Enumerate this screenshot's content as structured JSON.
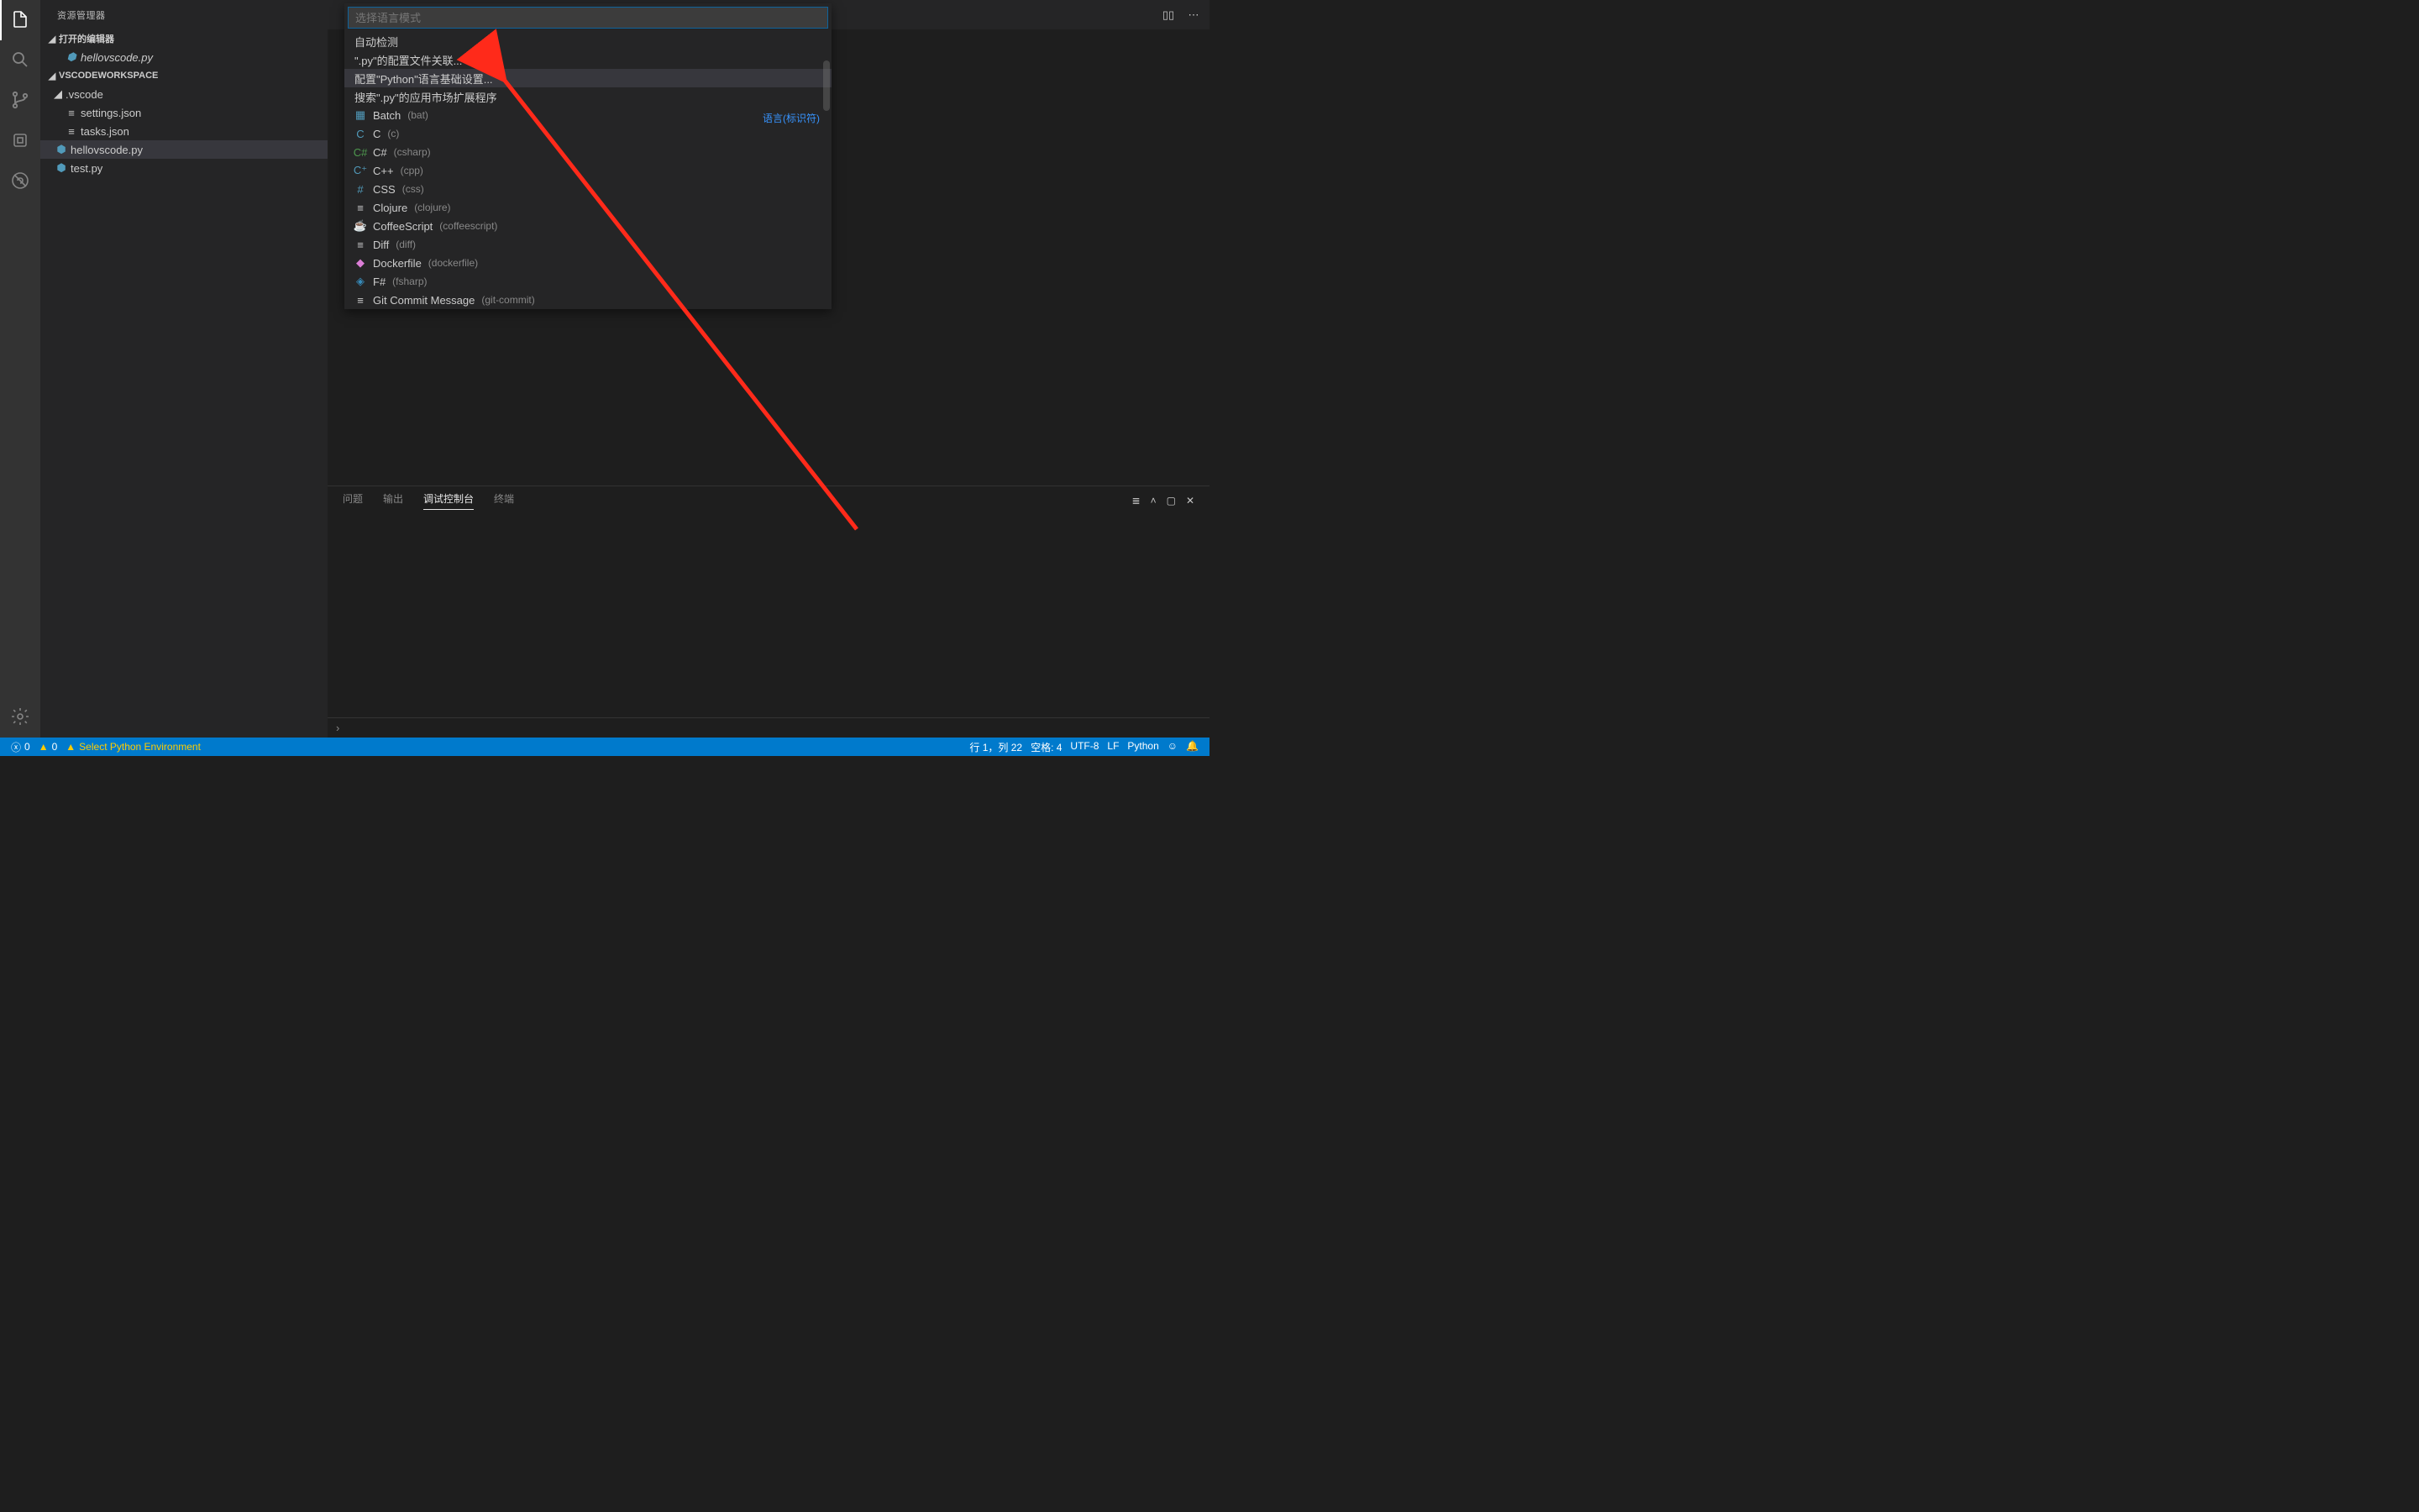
{
  "sidebar": {
    "title": "资源管理器",
    "open_editors_header": "打开的编辑器",
    "open_editors": [
      {
        "name": "hellovscode.py",
        "icon": "python"
      }
    ],
    "workspace_header": "VSCODEWORKSPACE",
    "tree": {
      "folder1": ".vscode",
      "settings": "settings.json",
      "tasks": "tasks.json",
      "file1": "hellovscode.py",
      "file2": "test.py"
    }
  },
  "quickpick": {
    "placeholder": "选择语言模式",
    "config_items": [
      "自动检测",
      "\".py\"的配置文件关联...",
      "配置\"Python\"语言基础设置...",
      "搜索\".py\"的应用市场扩展程序"
    ],
    "section_right_label": "语言(标识符)",
    "languages": [
      {
        "name": "Batch",
        "id": "bat",
        "iconCls": "li-batch",
        "glyph": "▦"
      },
      {
        "name": "C",
        "id": "c",
        "iconCls": "li-c",
        "glyph": "C"
      },
      {
        "name": "C#",
        "id": "csharp",
        "iconCls": "li-csharp",
        "glyph": "C#"
      },
      {
        "name": "C++",
        "id": "cpp",
        "iconCls": "li-cpp",
        "glyph": "C⁺"
      },
      {
        "name": "CSS",
        "id": "css",
        "iconCls": "li-css",
        "glyph": "#"
      },
      {
        "name": "Clojure",
        "id": "clojure",
        "iconCls": "li-clojure",
        "glyph": "≡"
      },
      {
        "name": "CoffeeScript",
        "id": "coffeescript",
        "iconCls": "li-coffee",
        "glyph": "☕"
      },
      {
        "name": "Diff",
        "id": "diff",
        "iconCls": "li-diff",
        "glyph": "≡"
      },
      {
        "name": "Dockerfile",
        "id": "dockerfile",
        "iconCls": "li-docker",
        "glyph": "◆"
      },
      {
        "name": "F#",
        "id": "fsharp",
        "iconCls": "li-fsharp",
        "glyph": "◈"
      },
      {
        "name": "Git Commit Message",
        "id": "git-commit",
        "iconCls": "li-git",
        "glyph": "≡"
      }
    ]
  },
  "panel": {
    "tabs": [
      "问题",
      "输出",
      "调试控制台",
      "终端"
    ],
    "active_index": 2,
    "prompt": "›"
  },
  "statusbar": {
    "errors": "0",
    "warnings": "0",
    "env": "Select Python Environment",
    "line_col": "行 1，列 22",
    "spaces": "空格: 4",
    "encoding": "UTF-8",
    "eol": "LF",
    "lang": "Python"
  },
  "tab_actions": {
    "split": "▯▯",
    "more": "⋯"
  }
}
